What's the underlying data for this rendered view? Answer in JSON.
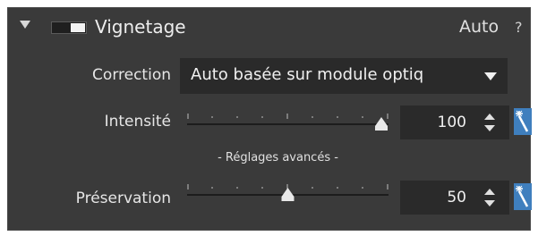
{
  "header": {
    "title": "Vignetage",
    "mode": "Auto",
    "help": "?"
  },
  "correction": {
    "label": "Correction",
    "selected": "Auto basée sur module optiq"
  },
  "intensity": {
    "label": "Intensité",
    "value": "100",
    "slider_fraction": 1.0
  },
  "advanced": {
    "label": "- Réglages avancés -"
  },
  "preservation": {
    "label": "Préservation",
    "value": "50",
    "slider_fraction": 0.5
  },
  "colors": {
    "panel_bg": "#3a3a3a",
    "field_bg": "#2a2a2a",
    "accent_blue": "#3f7fbe"
  },
  "icons": {
    "collapse": "triangle-down",
    "toggle": "on-off-switch",
    "spin": "up-down-arrows",
    "auto": "magic-wand"
  }
}
